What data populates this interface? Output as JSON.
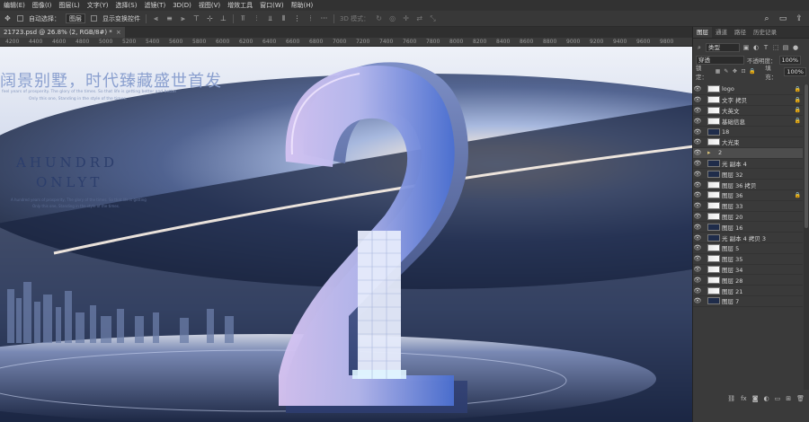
{
  "menu": [
    "编辑(E)",
    "图像(I)",
    "图层(L)",
    "文字(Y)",
    "选择(S)",
    "滤镜(T)",
    "3D(D)",
    "视图(V)",
    "增效工具",
    "窗口(W)",
    "帮助(H)"
  ],
  "options": {
    "auto_select_label": "自动选择：",
    "auto_select_value": "图层",
    "transform_label": "显示变换控件",
    "mode_label": "3D 模式："
  },
  "doc_tab": {
    "title": "21723.psd @ 26.8% (2, RGB/8#) *",
    "close": "×"
  },
  "ruler_ticks": [
    "4200",
    "4400",
    "4600",
    "4800",
    "5000",
    "5200",
    "5400",
    "5600",
    "5800",
    "6000",
    "6200",
    "6400",
    "6600",
    "6800",
    "7000",
    "7200",
    "7400",
    "7600",
    "7800",
    "8000",
    "8200",
    "8400",
    "8600",
    "8800",
    "9000",
    "9200",
    "9400",
    "9600",
    "9800"
  ],
  "canvas": {
    "headline": "阔景别墅，时代臻藏盛世首发",
    "sub1": "feel years of prosperity. The glory of the times. So that life is getting better and better",
    "sub2": "Only this one, Standing in the style of the times.",
    "brand1": "AHUNDRD",
    "brand2": "ONLYT",
    "sub3": "A hundred years of prosperity, The glory of the times. So that life is getting",
    "sub4": "Only this one, Standing in the style of the times.",
    "big_digit": "2"
  },
  "panel": {
    "tabs": [
      "图层",
      "通道",
      "路径",
      "历史记录"
    ],
    "filter_value": "类型",
    "blend_value": "穿透",
    "opacity_label": "不透明度：",
    "opacity_value": "100%",
    "lock_label": "锁定：",
    "fill_label": "填充：",
    "fill_value": "100%",
    "layers": [
      {
        "name": "logo",
        "thumb": "light",
        "lock": true,
        "sel": false
      },
      {
        "name": "文字 拷贝",
        "thumb": "light",
        "lock": true,
        "sel": false
      },
      {
        "name": "大英文",
        "thumb": "light",
        "lock": true,
        "sel": false
      },
      {
        "name": "基础信息",
        "thumb": "light",
        "lock": true,
        "sel": false
      },
      {
        "name": "18",
        "thumb": "dark",
        "lock": false,
        "sel": false
      },
      {
        "name": "大光束",
        "thumb": "light",
        "lock": false,
        "sel": false
      },
      {
        "name": "2",
        "thumb": "folder",
        "lock": false,
        "sel": true
      },
      {
        "name": "光 副本 4",
        "thumb": "dark",
        "lock": false,
        "sel": false
      },
      {
        "name": "图层 32",
        "thumb": "dark",
        "lock": false,
        "sel": false
      },
      {
        "name": "图层 36 拷贝",
        "thumb": "light",
        "lock": false,
        "sel": false
      },
      {
        "name": "图层 36",
        "thumb": "light",
        "lock": true,
        "sel": false
      },
      {
        "name": "图层 33",
        "thumb": "light",
        "lock": false,
        "sel": false
      },
      {
        "name": "图层 20",
        "thumb": "light",
        "lock": false,
        "sel": false
      },
      {
        "name": "图层 16",
        "thumb": "dark",
        "lock": false,
        "sel": false
      },
      {
        "name": "光 副本 4 拷贝 3",
        "thumb": "dark",
        "lock": false,
        "sel": false
      },
      {
        "name": "图层 5",
        "thumb": "light",
        "lock": false,
        "sel": false
      },
      {
        "name": "图层 35",
        "thumb": "light",
        "lock": false,
        "sel": false
      },
      {
        "name": "图层 34",
        "thumb": "light",
        "lock": false,
        "sel": false
      },
      {
        "name": "图层 28",
        "thumb": "light",
        "lock": false,
        "sel": false
      },
      {
        "name": "图层 21",
        "thumb": "light",
        "lock": false,
        "sel": false
      },
      {
        "name": "图层 7",
        "thumb": "dark",
        "lock": false,
        "sel": false
      }
    ]
  },
  "colors": {
    "menubar": "#323232",
    "panel": "#3a3a3a",
    "canvas_bg": "#1c2a45",
    "digit_light": "#c9b6ef",
    "digit_blue": "#3f63c9"
  }
}
